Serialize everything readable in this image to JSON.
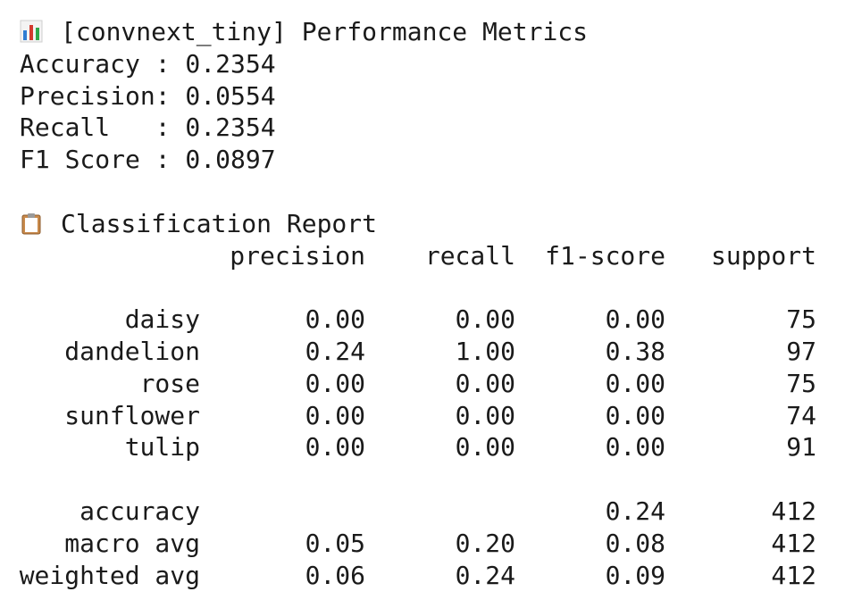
{
  "metrics": {
    "heading": "[convnext_tiny] Performance Metrics",
    "heading_icon": "bar-chart-icon",
    "lines": [
      "Accuracy : 0.2354",
      "Precision: 0.0554",
      "Recall   : 0.2354",
      "F1 Score : 0.0897"
    ]
  },
  "report": {
    "heading": "Classification Report",
    "heading_icon": "clipboard-icon",
    "columns": [
      "precision",
      "recall",
      "f1-score",
      "support"
    ],
    "class_rows": [
      {
        "label": "daisy",
        "precision": "0.00",
        "recall": "0.00",
        "f1": "0.00",
        "support": "75"
      },
      {
        "label": "dandelion",
        "precision": "0.24",
        "recall": "1.00",
        "f1": "0.38",
        "support": "97"
      },
      {
        "label": "rose",
        "precision": "0.00",
        "recall": "0.00",
        "f1": "0.00",
        "support": "75"
      },
      {
        "label": "sunflower",
        "precision": "0.00",
        "recall": "0.00",
        "f1": "0.00",
        "support": "74"
      },
      {
        "label": "tulip",
        "precision": "0.00",
        "recall": "0.00",
        "f1": "0.00",
        "support": "91"
      }
    ],
    "summary_rows": [
      {
        "label": "accuracy",
        "precision": "",
        "recall": "",
        "f1": "0.24",
        "support": "412"
      },
      {
        "label": "macro avg",
        "precision": "0.05",
        "recall": "0.20",
        "f1": "0.08",
        "support": "412"
      },
      {
        "label": "weighted avg",
        "precision": "0.06",
        "recall": "0.24",
        "f1": "0.09",
        "support": "412"
      }
    ]
  },
  "colors": {
    "text": "#1a1a1a",
    "background": "#ffffff"
  }
}
